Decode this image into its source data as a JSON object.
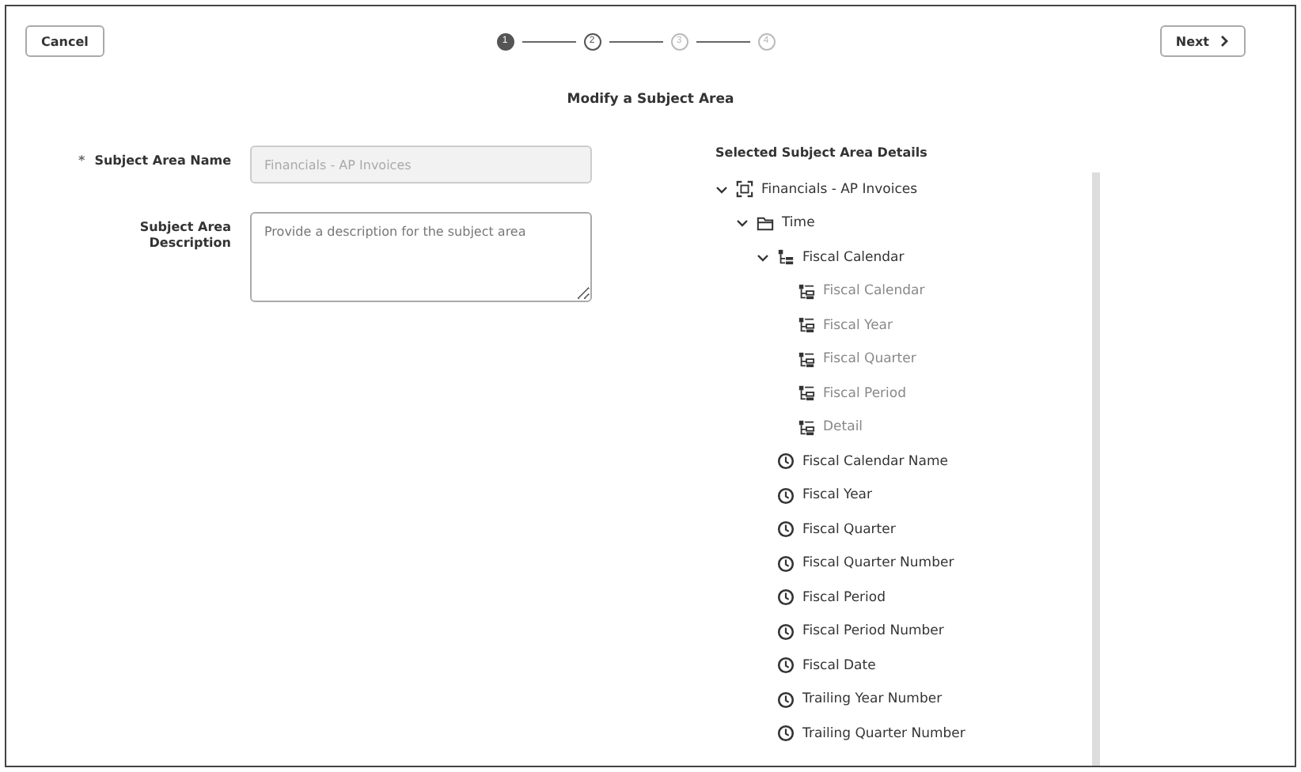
{
  "header": {
    "cancel_button": "Cancel",
    "next_button": "Next",
    "steps": [
      {
        "label": "1",
        "selected": true,
        "disabled": false
      },
      {
        "label": "2",
        "selected": false,
        "disabled": false
      },
      {
        "label": "3",
        "selected": false,
        "disabled": true
      },
      {
        "label": "4",
        "selected": false,
        "disabled": true
      }
    ],
    "title": "Modify a Subject Area"
  },
  "form": {
    "name_field": {
      "label": "Subject Area Name",
      "required_mark": "*",
      "value": "Financials - AP Invoices",
      "disabled": true
    },
    "description_field": {
      "label": "Subject Area Description",
      "placeholder": "Provide a description for the subject area"
    }
  },
  "details": {
    "heading": "Selected Subject Area Details",
    "tree": [
      {
        "kind": "subject-area",
        "label": "Financials - AP Invoices",
        "expanded": true,
        "children": [
          {
            "kind": "folder",
            "label": "Time",
            "expanded": true,
            "children": [
              {
                "kind": "hierarchy",
                "label": "Fiscal Calendar",
                "expanded": true,
                "children": [
                  {
                    "kind": "level",
                    "label": "Fiscal Calendar"
                  },
                  {
                    "kind": "level",
                    "label": "Fiscal Year"
                  },
                  {
                    "kind": "level",
                    "label": "Fiscal Quarter"
                  },
                  {
                    "kind": "level",
                    "label": "Fiscal Period"
                  },
                  {
                    "kind": "level",
                    "label": "Detail"
                  }
                ]
              },
              {
                "kind": "column",
                "label": "Fiscal Calendar Name"
              },
              {
                "kind": "column",
                "label": "Fiscal Year"
              },
              {
                "kind": "column",
                "label": "Fiscal Quarter"
              },
              {
                "kind": "column",
                "label": "Fiscal Quarter Number"
              },
              {
                "kind": "column",
                "label": "Fiscal Period"
              },
              {
                "kind": "column",
                "label": "Fiscal Period Number"
              },
              {
                "kind": "column",
                "label": "Fiscal Date"
              },
              {
                "kind": "column",
                "label": "Trailing Year Number"
              },
              {
                "kind": "column",
                "label": "Trailing Quarter Number"
              }
            ]
          }
        ]
      }
    ]
  }
}
